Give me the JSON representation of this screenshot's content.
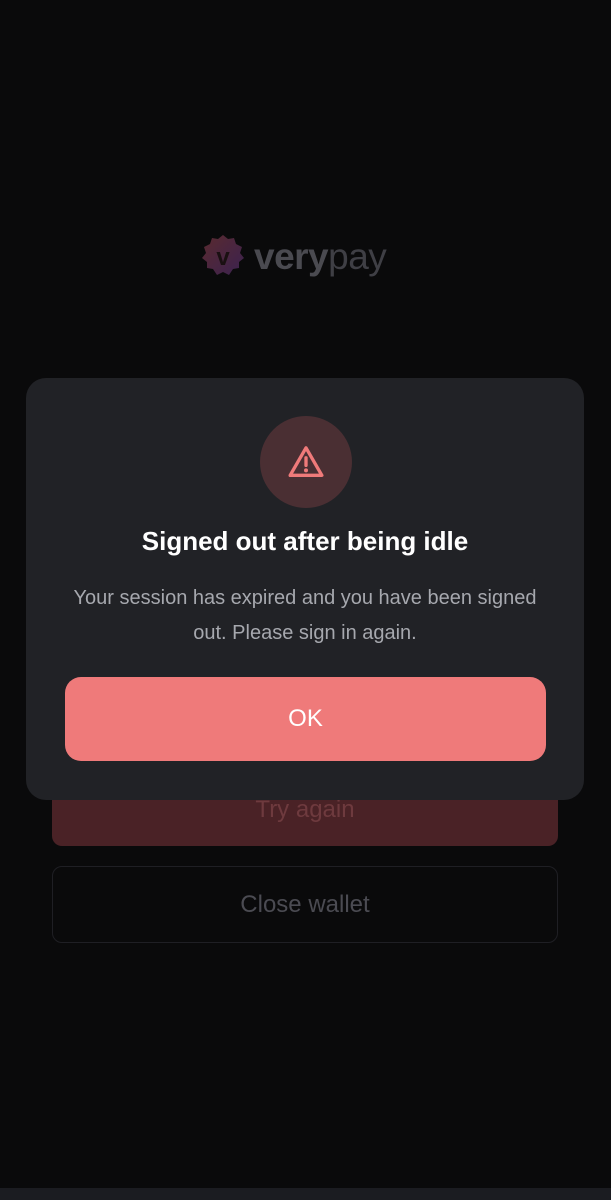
{
  "brand": {
    "logo_letter": "v",
    "name_part1": "very",
    "name_part2": "pay"
  },
  "background": {
    "try_again_label": "Try again",
    "close_wallet_label": "Close wallet"
  },
  "dialog": {
    "icon": "warning-triangle-icon",
    "title": "Signed out after being idle",
    "message": "Your session has expired and you have been signed out. Please sign in again.",
    "ok_label": "OK"
  },
  "colors": {
    "accent": "#ef7a7a",
    "modal_bg": "#212226",
    "page_bg": "#0a0a0b"
  }
}
